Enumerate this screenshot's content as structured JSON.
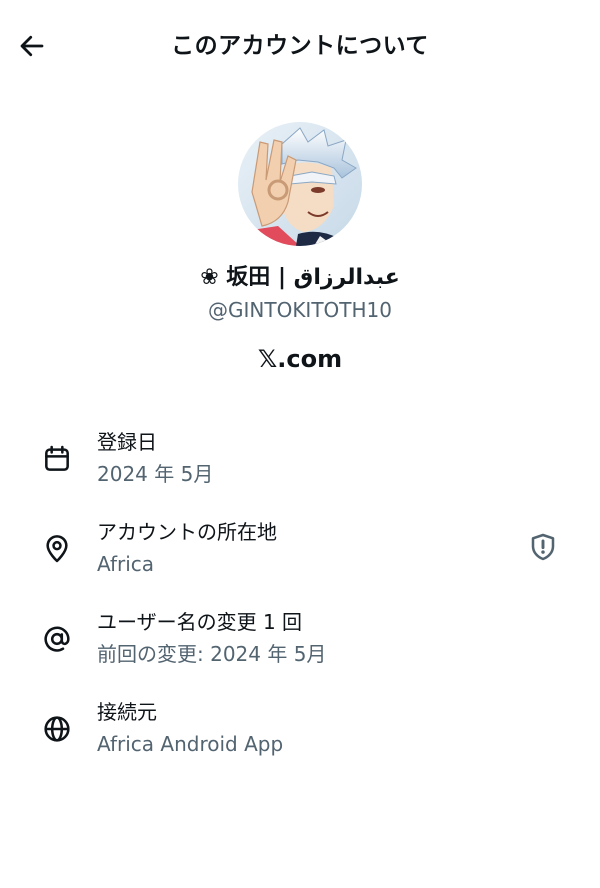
{
  "header": {
    "title": "このアカウントについて",
    "back_icon": "arrow-left-icon"
  },
  "profile": {
    "display_name": "❀ 坂田 | عبدالرزاق",
    "handle": "@GINTOKITOTH10",
    "verified_via": "𝕏.com"
  },
  "details": [
    {
      "icon": "calendar-icon",
      "label": "登録日",
      "value": "2024 年 5月"
    },
    {
      "icon": "location-pin-icon",
      "label": "アカウントの所在地",
      "value": "Africa",
      "trailing_icon": "shield-alert-icon"
    },
    {
      "icon": "at-sign-icon",
      "label": "ユーザー名の変更 1 回",
      "value": "前回の変更: 2024 年 5月"
    },
    {
      "icon": "globe-icon",
      "label": "接続元",
      "value": "Africa Android App"
    }
  ],
  "colors": {
    "text_primary": "#0f1419",
    "text_secondary": "#536471",
    "background": "#ffffff"
  }
}
